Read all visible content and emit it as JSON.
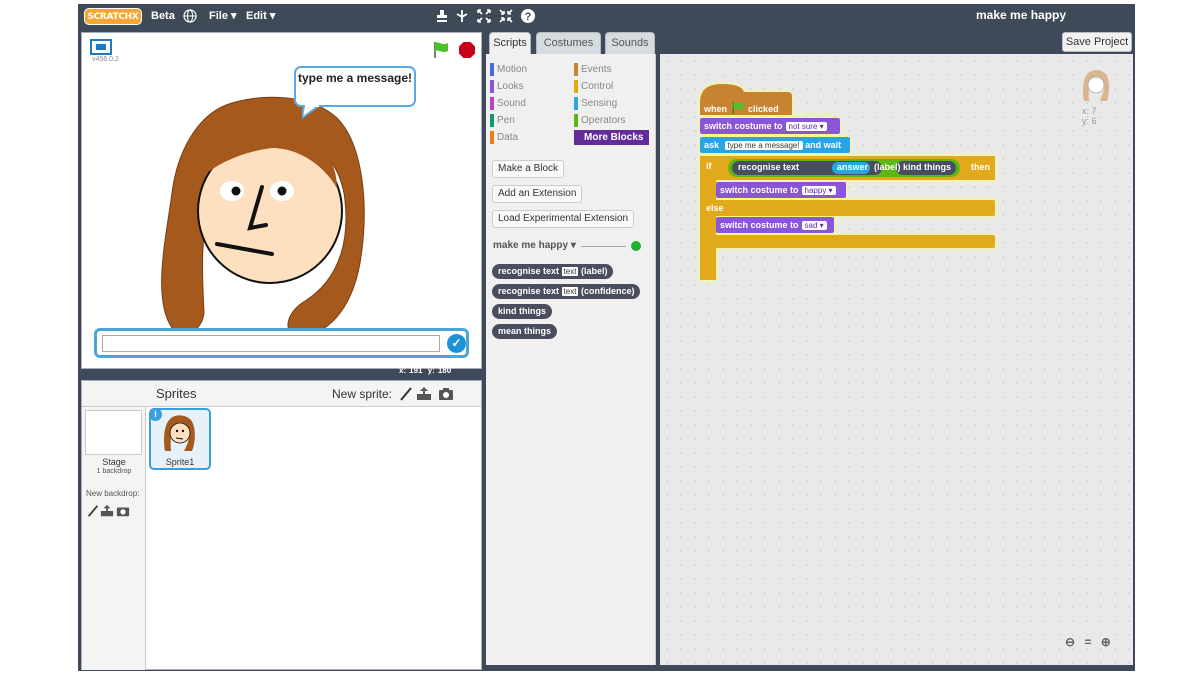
{
  "topbar": {
    "logo_text": "SCRATCHX",
    "beta_label": "Beta",
    "file_menu": "File ▾",
    "edit_menu": "Edit ▾",
    "project_title": "make me happy",
    "save_button": "Save Project"
  },
  "stage": {
    "version": "v456.0.2",
    "speech_bubble": "type me a message!",
    "ask_input_value": "",
    "mouse_x_label": "x:",
    "mouse_x": "191",
    "mouse_y_label": "y:",
    "mouse_y": "180"
  },
  "sprites_pane": {
    "title": "Sprites",
    "new_sprite_label": "New sprite:",
    "stage_label": "Stage",
    "backdrop_count": "1 backdrop",
    "new_backdrop_label": "New backdrop:",
    "sprites": [
      {
        "name": "Sprite1"
      }
    ]
  },
  "tabs": [
    "Scripts",
    "Costumes",
    "Sounds"
  ],
  "palette": {
    "categories_left": [
      {
        "label": "Motion",
        "color": "#4a6cd4"
      },
      {
        "label": "Looks",
        "color": "#8a55d7"
      },
      {
        "label": "Sound",
        "color": "#bb42c3"
      },
      {
        "label": "Pen",
        "color": "#0e9a6c"
      },
      {
        "label": "Data",
        "color": "#ee7d16"
      }
    ],
    "categories_right": [
      {
        "label": "Events",
        "color": "#c88330"
      },
      {
        "label": "Control",
        "color": "#e1a91a"
      },
      {
        "label": "Sensing",
        "color": "#2ca5e2"
      },
      {
        "label": "Operators",
        "color": "#5cb712"
      },
      {
        "label": "More Blocks",
        "color": "#632d99"
      }
    ],
    "make_block": "Make a Block",
    "add_extension": "Add an Extension",
    "load_experimental": "Load Experimental Extension",
    "extension_name": "make me happy ▾",
    "reporters": {
      "recognise_label": "recognise text",
      "text_slot": "text",
      "label_suffix": "(label)",
      "confidence_suffix": "(confidence)",
      "kind_things": "kind things",
      "mean_things": "mean things"
    }
  },
  "script": {
    "when_flag": "when",
    "clicked": "clicked",
    "switch_costume": "switch costume to",
    "costume_not_sure": "not sure",
    "ask": "ask",
    "ask_text": "type me a message!",
    "and_wait": "and wait",
    "if": "if",
    "recognise_text": "recognise text",
    "answer": "answer",
    "label": "(label)",
    "equals": "=",
    "kind_things": "kind things",
    "then": "then",
    "costume_happy": "happy",
    "else": "else",
    "costume_sad": "sad",
    "sprite_x_label": "x:",
    "sprite_x": "7",
    "sprite_y_label": "y:",
    "sprite_y": "6"
  },
  "zoom": {
    "zoom_out": "−",
    "reset": "=",
    "zoom_in": "+"
  }
}
